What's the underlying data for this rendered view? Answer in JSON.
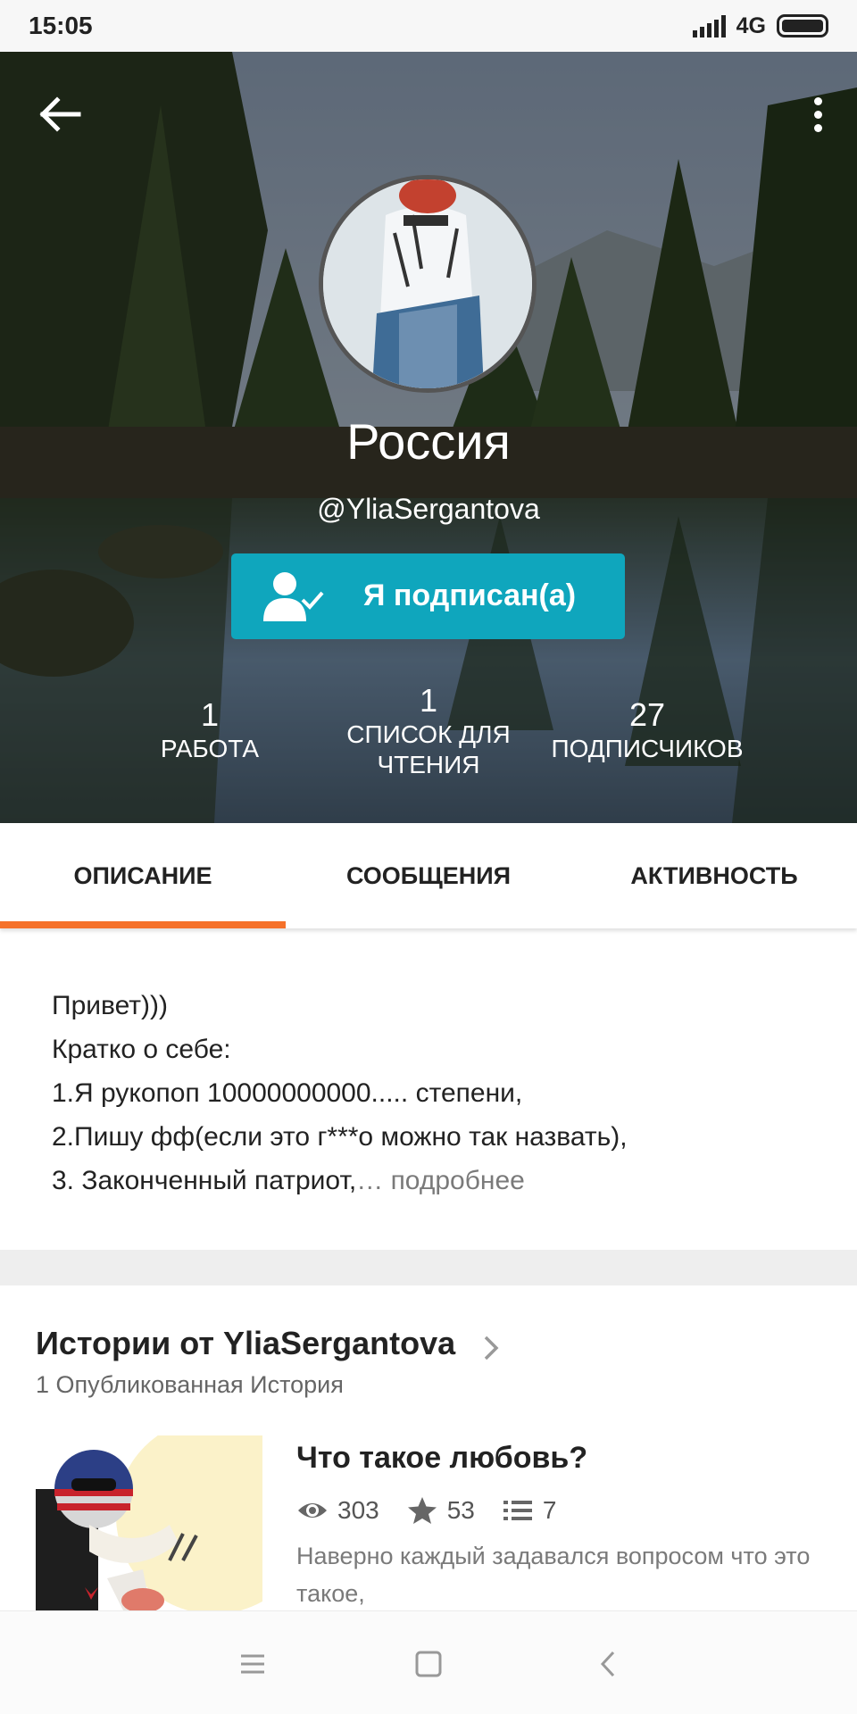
{
  "status_bar": {
    "time": "15:05",
    "network": "4G",
    "icons": [
      "signal-icon",
      "battery-icon"
    ]
  },
  "profile": {
    "name": "Россия",
    "handle": "@YliaSergantova",
    "follow_button_label": "Я подписан(а)",
    "stats": [
      {
        "value": "1",
        "label": "РАБОТА"
      },
      {
        "value": "1",
        "label_line1": "СПИСОК ДЛЯ",
        "label_line2": "ЧТЕНИЯ"
      },
      {
        "value": "27",
        "label": "ПОДПИСЧИКОВ"
      }
    ]
  },
  "tabs": [
    {
      "label": "ОПИСАНИЕ",
      "active": true
    },
    {
      "label": "СООБЩЕНИЯ",
      "active": false
    },
    {
      "label": "АКТИВНОСТЬ",
      "active": false
    }
  ],
  "description": {
    "lines": [
      "Привет)))",
      "Кратко о себе:",
      "1.Я рукопоп 10000000000..... степени,",
      "2.Пишу фф(если это г***о можно так назвать),",
      "3. Законченный патриот,"
    ],
    "ellipsis": "…",
    "more_label": "подробнее"
  },
  "stories": {
    "title": "Истории от YliaSergantova",
    "subtitle": "1 Опубликованная История",
    "items": [
      {
        "title": "Что такое любовь?",
        "views": "303",
        "votes": "53",
        "parts": "7",
        "description": "Наверно каждый задавался вопросом что это такое,"
      }
    ]
  },
  "colors": {
    "accent_orange": "#f5712a",
    "follow_teal": "#0fa6bd"
  }
}
